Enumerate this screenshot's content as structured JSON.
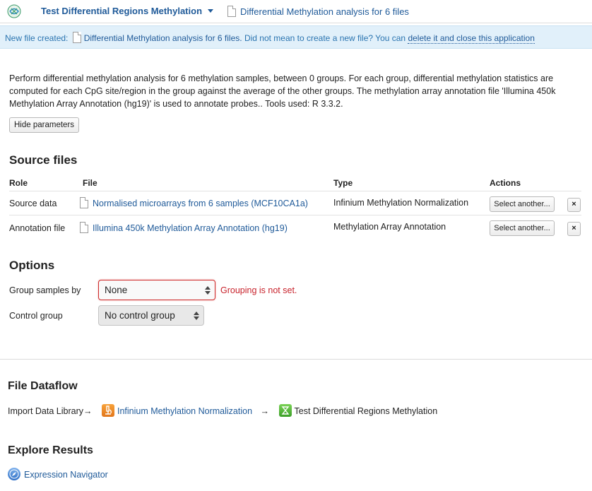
{
  "header": {
    "app_title": "Test Differential Regions Methylation",
    "file_title": "Differential Methylation analysis for 6 files"
  },
  "notice": {
    "prefix": "New file created:",
    "file_name": "Differential Methylation analysis for 6 files.",
    "middle": "Did not mean to create a new file? You can",
    "delete_link": "delete it and close this application"
  },
  "description": "Perform differential methylation analysis for 6 methylation samples, between 0 groups. For each group, differential methylation statistics are computed for each CpG site/region in the group against the average of the other groups. The methylation array annotation file 'Illumina 450k Methylation Array Annotation (hg19)' is used to annotate probes.. Tools used: R 3.3.2.",
  "hide_parameters_label": "Hide parameters",
  "source_files": {
    "heading": "Source files",
    "columns": {
      "role": "Role",
      "file": "File",
      "type": "Type",
      "actions": "Actions"
    },
    "rows": [
      {
        "role": "Source data",
        "file": "Normalised microarrays from 6 samples (MCF10CA1a)",
        "type": "Infinium Methylation Normalization",
        "action": "Select another...",
        "remove": "×"
      },
      {
        "role": "Annotation file",
        "file": "Illumina 450k Methylation Array Annotation (hg19)",
        "type": "Methylation Array Annotation",
        "action": "Select another...",
        "remove": "×"
      }
    ]
  },
  "options": {
    "heading": "Options",
    "group_samples": {
      "label": "Group samples by",
      "value": "None",
      "error": "Grouping is not set."
    },
    "control_group": {
      "label": "Control group",
      "value": "No control group"
    }
  },
  "dataflow": {
    "heading": "File Dataflow",
    "start": "Import Data Library",
    "arrow": "→",
    "step1": "Infinium Methylation Normalization",
    "step2": "Test Differential Regions Methylation"
  },
  "explore": {
    "heading": "Explore Results",
    "link": "Expression Navigator"
  },
  "colors": {
    "link": "#1f5a99",
    "notice_bg": "#e1f0fa",
    "error": "#c8232c"
  }
}
